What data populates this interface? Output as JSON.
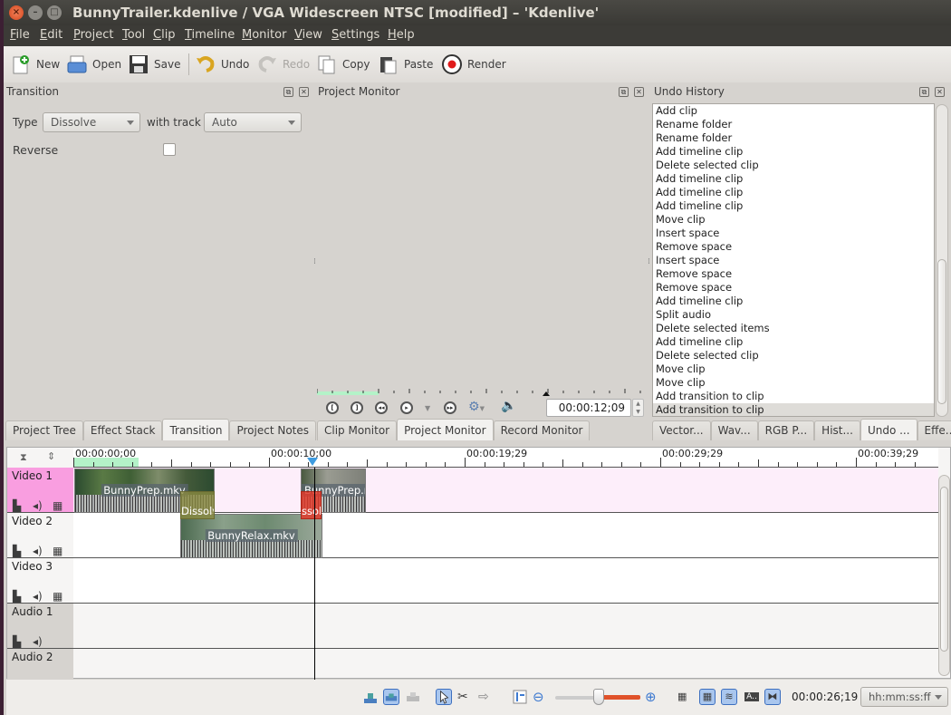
{
  "window": {
    "title": "BunnyTrailer.kdenlive / VGA Widescreen NTSC [modified] – 'Kdenlive'",
    "buttons": [
      "close-icon",
      "minimize-icon",
      "maximize-icon"
    ]
  },
  "menubar": [
    "File",
    "Edit",
    "Project",
    "Tool",
    "Clip",
    "Timeline",
    "Monitor",
    "View",
    "Settings",
    "Help"
  ],
  "toolbar": {
    "new": "New",
    "open": "Open",
    "save": "Save",
    "undo": "Undo",
    "redo": "Redo",
    "copy": "Copy",
    "paste": "Paste",
    "render": "Render"
  },
  "transition_panel": {
    "title": "Transition",
    "type_label": "Type",
    "type_value": "Dissolve",
    "with_track_label": "with track",
    "with_track_value": "Auto",
    "reverse_label": "Reverse",
    "reverse_checked": false
  },
  "left_tabs": [
    "Project Tree",
    "Effect Stack",
    "Transition",
    "Project Notes"
  ],
  "left_tab_active": "Transition",
  "project_monitor": {
    "title": "Project Monitor",
    "timecode": "00:00:12;09",
    "controls": [
      "set-zone-in-icon",
      "set-zone-out-icon",
      "rewind-icon",
      "play-icon",
      "forward-icon",
      "settings-icon",
      "volume-icon"
    ]
  },
  "monitor_tabs": [
    "Clip Monitor",
    "Project Monitor",
    "Record Monitor"
  ],
  "monitor_tab_active": "Project Monitor",
  "undo_history": {
    "title": "Undo History",
    "items": [
      "Add clip",
      "Rename folder",
      "Rename folder",
      "Add timeline clip",
      "Delete selected clip",
      "Add timeline clip",
      "Add timeline clip",
      "Add timeline clip",
      "Move clip",
      "Insert space",
      "Remove space",
      "Insert space",
      "Remove space",
      "Remove space",
      "Add timeline clip",
      "Split audio",
      "Delete selected items",
      "Add timeline clip",
      "Delete selected clip",
      "Move clip",
      "Move clip",
      "Add transition to clip",
      "Add transition to clip"
    ],
    "selected_index": 22
  },
  "right_tabs": [
    "Vector...",
    "Wav...",
    "RGB P...",
    "Hist...",
    "Undo ...",
    "Effe..."
  ],
  "right_tab_active": "Undo ...",
  "timeline": {
    "ruler_labels": [
      "00:00:00;00",
      "00:00:10;00",
      "00:00:19;29",
      "00:00:29;29",
      "00:00:39;29"
    ],
    "tracks": [
      {
        "name": "Video 1",
        "type": "video",
        "active": true
      },
      {
        "name": "Video 2",
        "type": "video",
        "active": false
      },
      {
        "name": "Video 3",
        "type": "video",
        "active": false
      },
      {
        "name": "Audio 1",
        "type": "audio",
        "active": false
      },
      {
        "name": "Audio 2",
        "type": "audio",
        "active": false
      }
    ],
    "clips": [
      {
        "name": "BunnyPrep.mkv",
        "track": "Video 1"
      },
      {
        "name": "BunnyPrep.mkv",
        "track": "Video 1"
      },
      {
        "name": "BunnyRelax.mkv",
        "track": "Video 2"
      }
    ],
    "transitions": [
      {
        "name": "Dissolve",
        "label": "Dissolv",
        "selected": false
      },
      {
        "name": "Dissolve",
        "label": "ssol",
        "selected": true
      }
    ],
    "position_timecode": "00:00:26;19",
    "time_format": "hh:mm:ss:ff",
    "zoom_fraction": 0.5
  },
  "colors": {
    "active_track": "#f99ee0",
    "selected_transition": "#e03a2a",
    "transition": "#8a8a40",
    "zone": "#b4f2c8",
    "zoom_slider": "#e0522a",
    "playhead_marker": "#3e9be0"
  }
}
